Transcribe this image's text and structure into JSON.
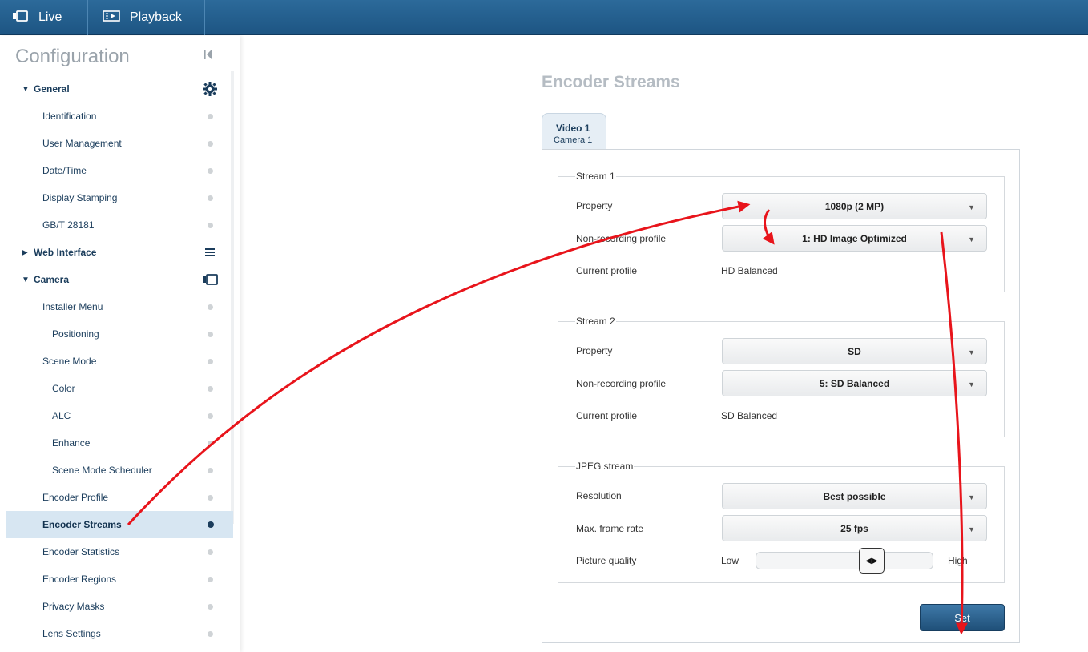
{
  "topbar": {
    "tabs": [
      {
        "label": "Live",
        "icon": "camera-icon"
      },
      {
        "label": "Playback",
        "icon": "playback-icon"
      }
    ]
  },
  "sidebar": {
    "title": "Configuration",
    "items": [
      {
        "label": "Identification"
      },
      {
        "label": "User Management"
      },
      {
        "label": "Date/Time"
      },
      {
        "label": "Display Stamping"
      },
      {
        "label": "GB/T 28181"
      },
      {
        "label": "Installer Menu"
      },
      {
        "label": "Positioning"
      },
      {
        "label": "Scene Mode"
      },
      {
        "label": "Color"
      },
      {
        "label": "ALC"
      },
      {
        "label": "Enhance"
      },
      {
        "label": "Scene Mode Scheduler"
      },
      {
        "label": "Encoder Profile"
      },
      {
        "label": "Encoder Streams"
      },
      {
        "label": "Encoder Statistics"
      },
      {
        "label": "Encoder Regions"
      },
      {
        "label": "Privacy Masks"
      },
      {
        "label": "Lens Settings"
      }
    ],
    "groups": [
      {
        "label": "General",
        "expanded": true,
        "icon": "gear-icon"
      },
      {
        "label": "Web Interface",
        "expanded": false,
        "icon": "menu-icon"
      },
      {
        "label": "Camera",
        "expanded": true,
        "icon": "camera-icon"
      }
    ],
    "active_item": "Encoder Streams"
  },
  "main": {
    "title": "Encoder Streams",
    "tab": {
      "title": "Video 1",
      "subtitle": "Camera 1"
    },
    "stream1": {
      "legend": "Stream 1",
      "property_label": "Property",
      "property_value": "1080p (2 MP)",
      "profile_label": "Non-recording profile",
      "profile_value": "1: HD Image Optimized",
      "current_label": "Current profile",
      "current_value": "HD Balanced"
    },
    "stream2": {
      "legend": "Stream 2",
      "property_label": "Property",
      "property_value": "SD",
      "profile_label": "Non-recording profile",
      "profile_value": "5: SD Balanced",
      "current_label": "Current profile",
      "current_value": "SD Balanced"
    },
    "jpeg": {
      "legend": "JPEG stream",
      "resolution_label": "Resolution",
      "resolution_value": "Best possible",
      "framerate_label": "Max. frame rate",
      "framerate_value": "25 fps",
      "quality_label": "Picture quality",
      "quality_low": "Low",
      "quality_high": "High",
      "quality_level": 0.68
    },
    "set_label": "Set"
  },
  "colors": {
    "topbar": "#1d5583",
    "nav_text": "#1b3d5c",
    "active_bg": "#d7e6f2",
    "annotation": "#e8141b"
  }
}
